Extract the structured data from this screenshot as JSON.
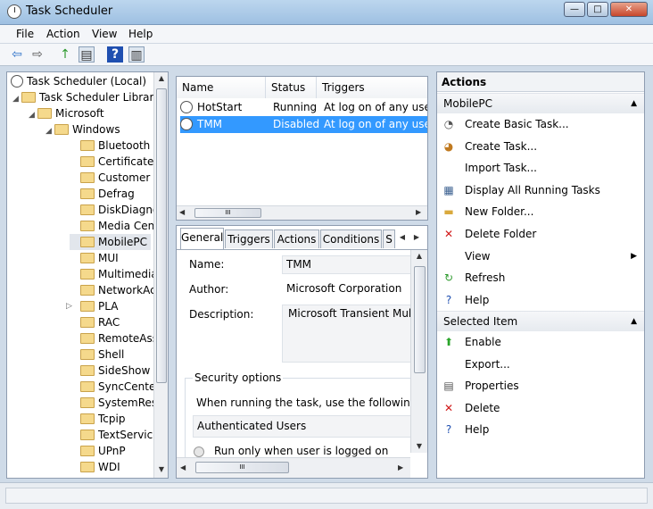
{
  "window": {
    "title": "Task Scheduler",
    "minimize": "—",
    "maximize": "□",
    "close": "✕"
  },
  "menu": [
    "File",
    "Action",
    "View",
    "Help"
  ],
  "toolbar": {
    "back": "⇦",
    "forward": "⇨",
    "up": "↑",
    "show_hide": "▤",
    "help": "?",
    "props": "▥"
  },
  "tree": {
    "root": "Task Scheduler (Local)",
    "library": "Task Scheduler Library",
    "microsoft": "Microsoft",
    "windows": "Windows",
    "folders": [
      "Bluetooth",
      "CertificateS",
      "Customer E",
      "Defrag",
      "DiskDiagno",
      "Media Cent",
      "MobilePC",
      "MUI",
      "Multimedia",
      "NetworkAc",
      "PLA",
      "RAC",
      "RemoteAss",
      "Shell",
      "SideShow",
      "SyncCenter",
      "SystemRest",
      "Tcpip",
      "TextService",
      "UPnP",
      "WDI"
    ],
    "selected": "MobilePC",
    "expandable": "PLA"
  },
  "task_list": {
    "columns": [
      "Name",
      "Status",
      "Triggers"
    ],
    "rows": [
      {
        "name": "HotStart",
        "status": "Running",
        "trigger": "At log on of any user"
      },
      {
        "name": "TMM",
        "status": "Disabled",
        "trigger": "At log on of any user"
      }
    ],
    "selected": "TMM"
  },
  "tabs": [
    "General",
    "Triggers",
    "Actions",
    "Conditions",
    "S"
  ],
  "general": {
    "name_label": "Name:",
    "name_value": "TMM",
    "author_label": "Author:",
    "author_value": "Microsoft Corporation",
    "description_label": "Description:",
    "description_value": "Microsoft Transient Multi-",
    "security_legend": "Security options",
    "security_text": "When running the task, use the following use",
    "security_user": "Authenticated Users",
    "run_only_label": "Run only when user is logged on"
  },
  "actions_panel": {
    "header": "Actions",
    "section1": "MobilePC",
    "section1_items": [
      {
        "icon": "create-basic-task-icon",
        "glyph": "◔",
        "color": "#555555",
        "label": "Create Basic Task..."
      },
      {
        "icon": "create-task-icon",
        "glyph": "◕",
        "color": "#c07a20",
        "label": "Create Task..."
      },
      {
        "icon": "",
        "glyph": "",
        "color": "#000000",
        "label": "Import Task..."
      },
      {
        "icon": "running-tasks-icon",
        "glyph": "▦",
        "color": "#3a5f8f",
        "label": "Display All Running Tasks"
      },
      {
        "icon": "new-folder-icon",
        "glyph": "▬",
        "color": "#d9a93d",
        "label": "New Folder..."
      },
      {
        "icon": "delete-folder-icon",
        "glyph": "✕",
        "color": "#d11a1a",
        "label": "Delete Folder"
      },
      {
        "icon": "",
        "glyph": "",
        "color": "#000000",
        "label": "View"
      },
      {
        "icon": "refresh-icon",
        "glyph": "↻",
        "color": "#2d9a2d",
        "label": "Refresh"
      },
      {
        "icon": "help-icon",
        "glyph": "?",
        "color": "#1f4fb0",
        "label": "Help"
      }
    ],
    "section2": "Selected Item",
    "section2_items": [
      {
        "icon": "enable-icon",
        "glyph": "⬆",
        "color": "#2aa52a",
        "label": "Enable"
      },
      {
        "icon": "",
        "glyph": "",
        "color": "#000000",
        "label": "Export..."
      },
      {
        "icon": "properties-icon",
        "glyph": "▤",
        "color": "#555555",
        "label": "Properties"
      },
      {
        "icon": "delete-icon",
        "glyph": "✕",
        "color": "#d11a1a",
        "label": "Delete"
      },
      {
        "icon": "help-icon",
        "glyph": "?",
        "color": "#1f4fb0",
        "label": "Help"
      }
    ]
  },
  "scroll": {
    "h_thumb": "III"
  }
}
